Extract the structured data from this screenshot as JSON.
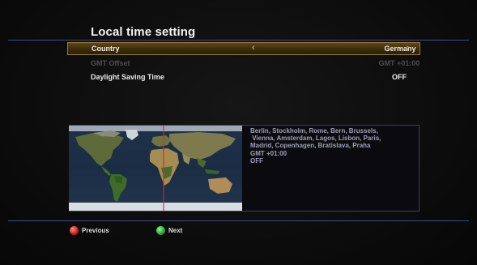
{
  "screen": {
    "title": "Local time setting"
  },
  "settings": [
    {
      "label": "Country",
      "value": "Germany",
      "state": "selected"
    },
    {
      "label": "GMT Offset",
      "value": "GMT +01:00",
      "state": "disabled"
    },
    {
      "label": "Daylight Saving Time",
      "value": "OFF",
      "state": "normal"
    }
  ],
  "info": {
    "lines": [
      "Berlin, Stockholm, Rome, Bern, Brussels,",
      " Vienna, Amsterdam, Lagos, Lisbon, Paris,",
      "Madrid, Copenhagen, Bratislava, Praha",
      "GMT +01:00",
      "OFF"
    ]
  },
  "footer": {
    "previous_label": "Previous",
    "next_label": "Next"
  },
  "colors": {
    "accent_line": "#3d4a86",
    "highlight": "#5e4817",
    "previous_key": "#d62222",
    "next_key": "#2ea836"
  },
  "icons": {
    "left": "chevron-left-icon",
    "right": "chevron-right-icon"
  }
}
